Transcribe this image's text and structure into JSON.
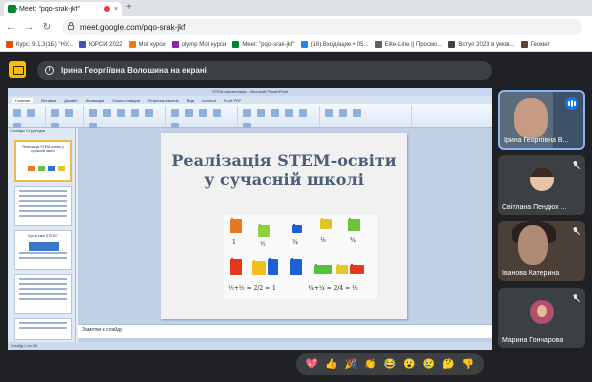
{
  "browser": {
    "tab_title": "Meet: \"pqo-srak-jkf\"",
    "close_glyph": "×",
    "new_tab_glyph": "+",
    "url": "meet.google.com/pqo-srak-jkf",
    "back_glyph": "←",
    "forward_glyph": "→",
    "reload_glyph": "↻"
  },
  "bookmarks": [
    {
      "label": "Курс: 9.1.3(1Б) \"НУ...",
      "color": "#e65100"
    },
    {
      "label": "ЮРСИ 2022",
      "color": "#3f51b5"
    },
    {
      "label": "Мої курси",
      "color": "#f57c00"
    },
    {
      "label": "olymp Мої курси",
      "color": "#8e24aa"
    },
    {
      "label": "Meet: \"pqo-srak-jkf\"",
      "color": "#00832d"
    },
    {
      "label": "(16) Входящие • 05...",
      "color": "#1e88e5"
    },
    {
      "label": "Elite-Line || Просмо...",
      "color": "#616161"
    },
    {
      "label": "Вступ 2023 в умов...",
      "color": "#424242"
    },
    {
      "label": "Геомет",
      "color": "#5d4037"
    }
  ],
  "meet": {
    "presenter_banner": "Ірина Георгіївна Волошина на екрані",
    "presentation_icon": "present-to-all-icon",
    "info_icon": "info-icon"
  },
  "powerpoint": {
    "window_title": "STEM-презентація - Microsoft PowerPoint",
    "ribbon_tabs": [
      "Главная",
      "Вставка",
      "Дизайн",
      "Анимация",
      "Показ слайдов",
      "Рецензирование",
      "Вид",
      "Acrobat",
      "Foxit PDF"
    ],
    "panel_tabs": "Слайды   Структура",
    "thumbnails": [
      {
        "title": "Реалізація STEM-освіти у сучасній школі"
      },
      {
        "title": ""
      },
      {
        "title": "Що ж таке STEM?"
      },
      {
        "title": ""
      },
      {
        "title": ""
      }
    ],
    "slide_title_line1": "Реалізація STEM-освіти",
    "slide_title_line2": "у сучасній школі",
    "notes_placeholder": "Заметки к слайду",
    "status_text": "Слайд 1 из 20"
  },
  "participants": [
    {
      "name": "Ірина Георгіївна В...",
      "speaking": true
    },
    {
      "name": "Світлана Пендюх ...",
      "muted": true
    },
    {
      "name": "Іванова Катерина",
      "muted": true
    },
    {
      "name": "Марина Гончарова",
      "muted": true
    }
  ],
  "reactions": [
    "💖",
    "👍",
    "🎉",
    "👏",
    "😂",
    "😮",
    "😢",
    "🤔",
    "👎"
  ],
  "colors": {
    "meet_bg": "#202124",
    "active_speaker_border": "#8ab4f8",
    "present_icon": "#fbbc04",
    "slide_title": "#4b5d77"
  }
}
